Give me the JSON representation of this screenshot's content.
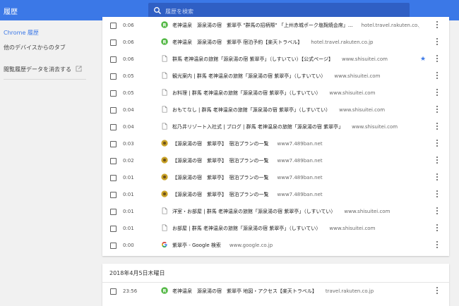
{
  "app": {
    "title": "履歴"
  },
  "search": {
    "placeholder": "履歴を検索"
  },
  "sidebar": {
    "items": [
      {
        "label": "Chrome 履歴",
        "active": true
      },
      {
        "label": "他のデバイスからのタブ"
      },
      {
        "label": "閲覧履歴データを消去する"
      }
    ]
  },
  "groups": [
    {
      "header": "",
      "entries": [
        {
          "time": "0:06",
          "favicon": "rakuten-r",
          "title": "老神温泉　源泉湯の宿　紫翠亭 \"群馬の招柄際\" 「上州赤城ポーク塩麹焼会席」...",
          "domain": "hotel.travel.rakuten.co.jp",
          "starred": false
        },
        {
          "time": "0:06",
          "favicon": "rakuten-r",
          "title": "老神温泉　源泉湯の宿　紫翠亭 宿泊予約【楽天トラベル】",
          "domain": "hotel.travel.rakuten.co.jp",
          "starred": false
        },
        {
          "time": "0:06",
          "favicon": "page",
          "title": "群馬 老神温泉の旅館「源泉湯の宿 紫翠亭」（しすいてい）【公式ページ】",
          "domain": "www.shisuitei.com",
          "starred": true
        },
        {
          "time": "0:05",
          "favicon": "page",
          "title": "観光案内 | 群馬 老神温泉の旅館「源泉湯の宿 紫翠亭」（しすいてい）",
          "domain": "www.shisuitei.com",
          "starred": false
        },
        {
          "time": "0:05",
          "favicon": "page",
          "title": "お料理 | 群馬 老神温泉の旅館「源泉湯の宿 紫翠亭」（しすいてい）",
          "domain": "www.shisuitei.com",
          "starred": false
        },
        {
          "time": "0:04",
          "favicon": "page",
          "title": "おもてなし | 群馬 老神温泉の旅館「源泉湯の宿 紫翠亭」（しすいてい）",
          "domain": "www.shisuitei.com",
          "starred": false
        },
        {
          "time": "0:04",
          "favicon": "page",
          "title": "松乃井リゾート入社式 | ブログ | 群馬 老神温泉の旅館「源泉湯の宿 紫翠亭」",
          "domain": "www.shisuitei.com",
          "starred": false
        },
        {
          "time": "0:03",
          "favicon": "yellow-dot",
          "title": "【源泉湯の宿　紫翠亭】　宿泊プランの一覧",
          "domain": "www7.489ban.net",
          "starred": false
        },
        {
          "time": "0:02",
          "favicon": "yellow-dot",
          "title": "【源泉湯の宿　紫翠亭】　宿泊プランの一覧",
          "domain": "www7.489ban.net",
          "starred": false
        },
        {
          "time": "0:01",
          "favicon": "yellow-dot",
          "title": "【源泉湯の宿　紫翠亭】　宿泊プランの一覧",
          "domain": "www7.489ban.net",
          "starred": false
        },
        {
          "time": "0:01",
          "favicon": "yellow-dot",
          "title": "【源泉湯の宿　紫翠亭】　宿泊プランの一覧",
          "domain": "www7.489ban.net",
          "starred": false
        },
        {
          "time": "0:01",
          "favicon": "page",
          "title": "洋室・お部屋 | 群馬 老神温泉の旅館「源泉湯の宿 紫翠亭」（しすいてい）",
          "domain": "www.shisuitei.com",
          "starred": false
        },
        {
          "time": "0:01",
          "favicon": "page",
          "title": "お部屋 | 群馬 老神温泉の旅館「源泉湯の宿 紫翠亭」（しすいてい）",
          "domain": "www.shisuitei.com",
          "starred": false
        },
        {
          "time": "0:00",
          "favicon": "google-g",
          "title": "紫翠亭 - Google 検索",
          "domain": "www.google.co.jp",
          "starred": false
        }
      ]
    },
    {
      "header": "2018年4月5日木曜日",
      "entries": [
        {
          "time": "23:56",
          "favicon": "rakuten-r",
          "title": "老神温泉　源泉湯の宿　紫翠亭 地図・アクセス【楽天トラベル】",
          "domain": "travel.rakuten.co.jp",
          "starred": false
        }
      ]
    }
  ],
  "colors": {
    "accent": "#3b78e7",
    "rakuten": "#56b948",
    "yellow_favicon": "#c9a227"
  }
}
